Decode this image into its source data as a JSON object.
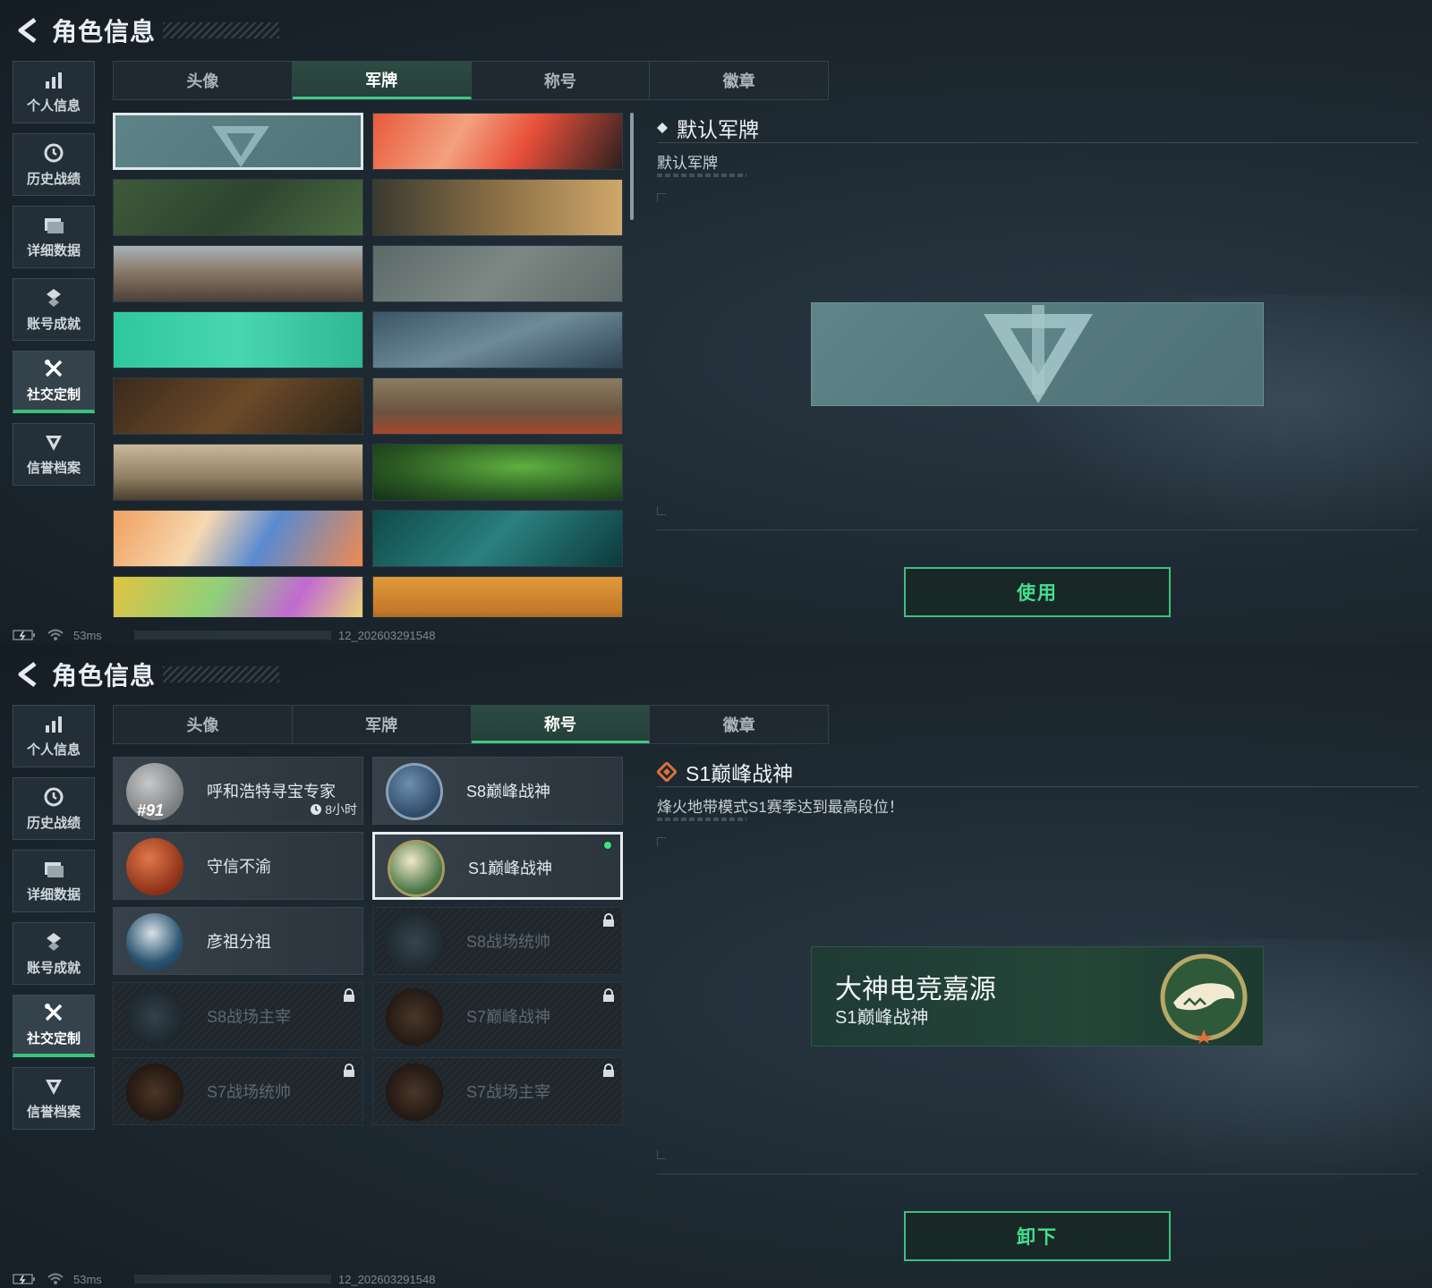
{
  "header": {
    "title": "角色信息"
  },
  "sidebar": {
    "items": [
      {
        "label": "个人信息",
        "icon": "bar-chart-icon"
      },
      {
        "label": "历史战绩",
        "icon": "clock-icon"
      },
      {
        "label": "详细数据",
        "icon": "folder-icon"
      },
      {
        "label": "账号成就",
        "icon": "trophy-icon"
      },
      {
        "label": "社交定制",
        "icon": "tools-icon"
      },
      {
        "label": "信誉档案",
        "icon": "shield-icon"
      }
    ],
    "active_index": 4
  },
  "tabs": [
    "头像",
    "军牌",
    "称号",
    "徽章"
  ],
  "top_panel": {
    "active_tab": "军牌",
    "plates": [
      {
        "theme": "default-logo",
        "selected": true
      },
      {
        "theme": "orange-splash"
      },
      {
        "theme": "green-rifles"
      },
      {
        "theme": "desert-soldiers"
      },
      {
        "theme": "desert-tank"
      },
      {
        "theme": "fog-sniper"
      },
      {
        "theme": "green-cartoon"
      },
      {
        "theme": "sky-helicopter"
      },
      {
        "theme": "weapons-table"
      },
      {
        "theme": "plane-crash"
      },
      {
        "theme": "sniper-desert"
      },
      {
        "theme": "night-vision"
      },
      {
        "theme": "orange-blue-art"
      },
      {
        "theme": "teal-gym"
      },
      {
        "theme": "anime-headphones"
      },
      {
        "theme": "surreal-desert"
      }
    ],
    "detail": {
      "name": "默认军牌",
      "description": "默认军牌",
      "button": "使用"
    },
    "status": {
      "ping": "53ms",
      "version": "12_202603291548"
    }
  },
  "bottom_panel": {
    "active_tab": "称号",
    "titles": [
      {
        "name": "呼和浩特寻宝专家",
        "rank": "#91",
        "timer": "8小时",
        "locked": false,
        "badge_color": "#8c8f92"
      },
      {
        "name": "S8巅峰战神",
        "locked": false,
        "badge_color": "#3d5a7a"
      },
      {
        "name": "守信不渝",
        "locked": false,
        "badge_color": "#a7462a"
      },
      {
        "name": "S1巅峰战神",
        "locked": false,
        "selected": true,
        "equipped": true,
        "badge_color": "#3f6a44"
      },
      {
        "name": "彦祖分祖",
        "locked": false,
        "badge_color": "#2c5d7a"
      },
      {
        "name": "S8战场统帅",
        "locked": true,
        "badge_color": "#2d3b45"
      },
      {
        "name": "S8战场主宰",
        "locked": true,
        "badge_color": "#2a3740"
      },
      {
        "name": "S7巅峰战神",
        "locked": true,
        "badge_color": "#3d2e24"
      },
      {
        "name": "S7战场统帅",
        "locked": true,
        "badge_color": "#3e2c22"
      },
      {
        "name": "S7战场主宰",
        "locked": true,
        "badge_color": "#3a2b24"
      }
    ],
    "detail": {
      "name": "S1巅峰战神",
      "description": "烽火地带模式S1赛季达到最高段位！",
      "preview_player": "大神电竞嘉源",
      "preview_title": "S1巅峰战神",
      "button": "卸下"
    },
    "status": {
      "ping": "53ms",
      "version": "12_202603291548"
    }
  },
  "colors": {
    "accent_green": "#3ec982",
    "diamond_orange": "#e0703a"
  }
}
